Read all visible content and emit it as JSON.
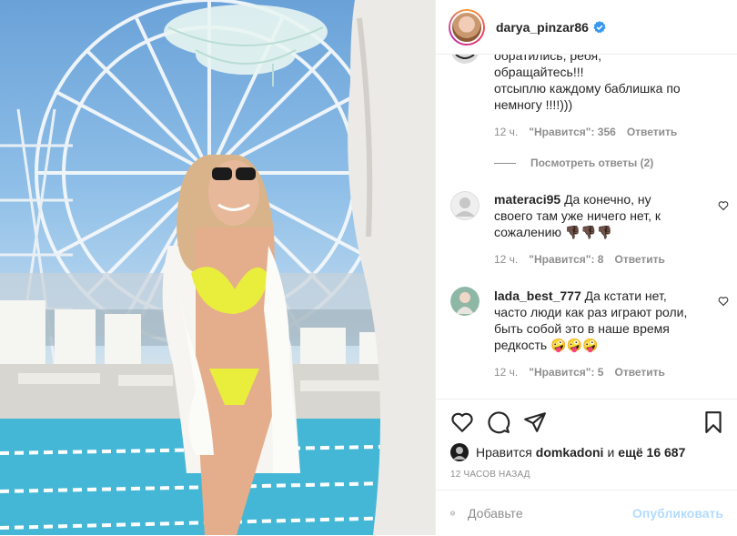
{
  "header": {
    "username": "darya_pinzar86"
  },
  "comments": {
    "top_comment": {
      "line1": "обратились, ребя,",
      "line2": "обращайтесь!!!",
      "line3": "отсыплю каждому баблишка по",
      "line4": "немногу !!!!)))",
      "time": "12 ч.",
      "likes": "\"Нравится\": 356",
      "reply": "Ответить",
      "view_replies": "Посмотреть ответы (2)"
    },
    "c2": {
      "user": "materaci95",
      "line1": "Да конечно, ну",
      "line2": "своего там уже ничего нет, к",
      "line3": "сожалению 👎🏿👎🏿👎🏿",
      "time": "12 ч.",
      "likes": "\"Нравится\": 8",
      "reply": "Ответить"
    },
    "c3": {
      "user": "lada_best_777",
      "line1": "Да кстати нет,",
      "line2": "часто люди как раз играют роли,",
      "line3": "быть собой это в наше время",
      "line4": "редкость 🤪🤪🤪",
      "time": "12 ч.",
      "likes": "\"Нравится\": 5",
      "reply": "Ответить"
    }
  },
  "actions": {
    "likes_prefix": "Нравится",
    "likes_user": "domkadoni",
    "likes_mid": "и",
    "likes_count": "ещё 16 687",
    "time_ago": "12 ЧАСОВ НАЗАД",
    "add_placeholder": "Добавьте",
    "publish": "Опубликовать"
  },
  "colors": {
    "accent": "#0095f6",
    "publish_disabled": "#b3dbff",
    "muted": "#8e8e8e"
  }
}
